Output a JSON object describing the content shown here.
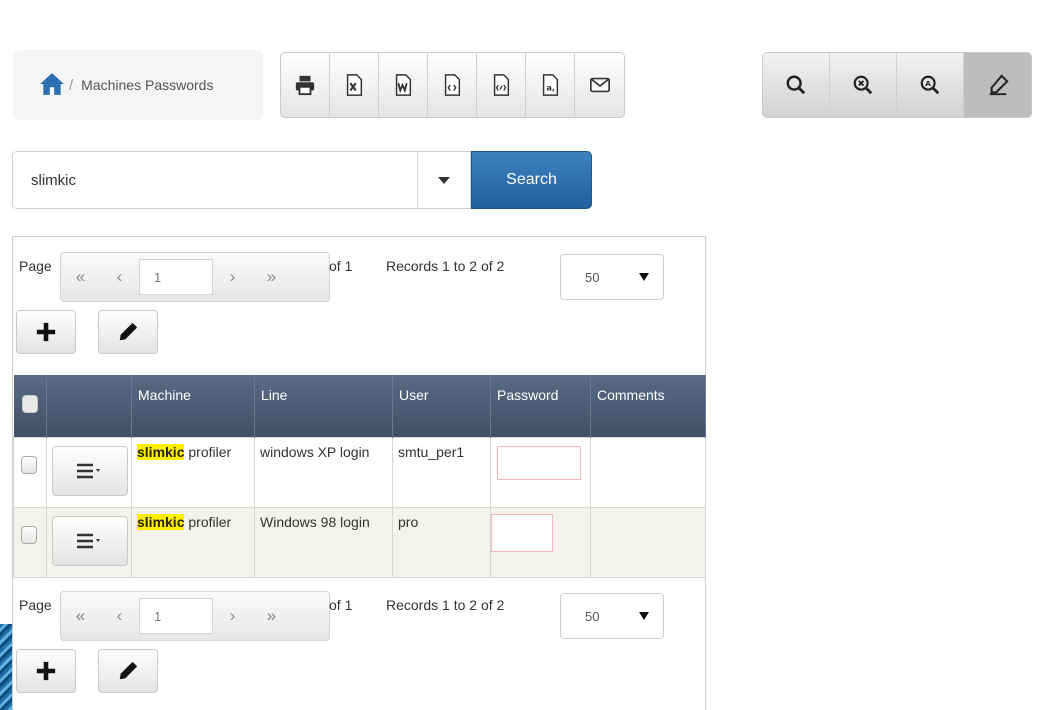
{
  "breadcrumb": {
    "home_icon": "home-icon",
    "separator": "/",
    "label": "Machines Passwords"
  },
  "export_toolbar": [
    {
      "name": "print-button",
      "icon": "print-icon"
    },
    {
      "name": "export-excel-button",
      "icon": "excel-icon"
    },
    {
      "name": "export-word-button",
      "icon": "word-icon"
    },
    {
      "name": "export-html-button",
      "icon": "html-icon"
    },
    {
      "name": "export-xml-button",
      "icon": "xml-icon"
    },
    {
      "name": "export-csv-button",
      "icon": "text-icon"
    },
    {
      "name": "email-button",
      "icon": "envelope-icon"
    }
  ],
  "search_toolbar": [
    {
      "name": "search-panel-button",
      "icon": "search-icon"
    },
    {
      "name": "reset-search-button",
      "icon": "search-reset-icon"
    },
    {
      "name": "advanced-search-button",
      "icon": "search-advanced-icon"
    },
    {
      "name": "highlight-button",
      "icon": "highlighter-icon"
    }
  ],
  "search": {
    "value": "slimkic",
    "button_label": "Search"
  },
  "pager": {
    "page_label": "Page",
    "current_page": "1",
    "of_label": "of 1",
    "records_label": "Records 1 to 2 of 2",
    "page_size": "50"
  },
  "table": {
    "columns": [
      "Machine",
      "Line",
      "User",
      "Password",
      "Comments"
    ],
    "rows": [
      {
        "machine_highlight": "slimkic",
        "machine_rest": " profiler",
        "line": "windows XP login",
        "user": "smtu_per1",
        "password": "",
        "comments": ""
      },
      {
        "machine_highlight": "slimkic",
        "machine_rest": " profiler",
        "line": "Windows 98 login",
        "user": "pro",
        "password": "",
        "comments": ""
      }
    ]
  },
  "colors": {
    "header_bg": "#4b5b72",
    "highlight": "#ffef00",
    "search_button": "#2c6aa8"
  }
}
